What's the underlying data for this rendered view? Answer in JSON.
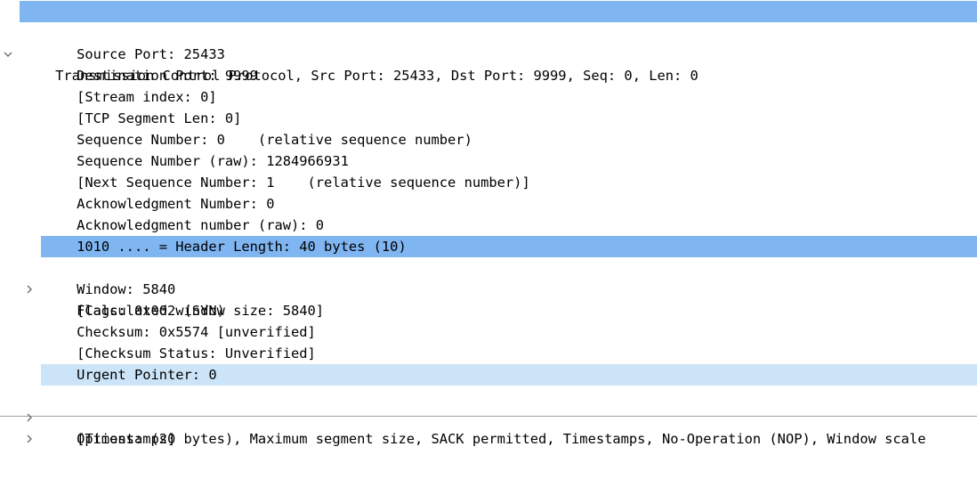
{
  "tree": {
    "header": {
      "label": "Transmission Control Protocol, Src Port: 25433, Dst Port: 9999, Seq: 0, Len: 0",
      "expanded": true,
      "icon": "chevron-down-icon"
    },
    "fields": [
      {
        "label": "Source Port: 25433"
      },
      {
        "label": "Destination Port: 9999"
      },
      {
        "label": "[Stream index: 0]"
      },
      {
        "label": "[TCP Segment Len: 0]"
      },
      {
        "label": "Sequence Number: 0    (relative sequence number)"
      },
      {
        "label": "Sequence Number (raw): 1284966931"
      },
      {
        "label": "[Next Sequence Number: 1    (relative sequence number)]"
      },
      {
        "label": "Acknowledgment Number: 0"
      },
      {
        "label": "Acknowledgment number (raw): 0"
      },
      {
        "label": "1010 .... = Header Length: 40 bytes (10)"
      },
      {
        "label": "Flags: 0x002 (SYN)",
        "expandable": true,
        "icon": "chevron-right-icon"
      },
      {
        "label": "Window: 5840"
      },
      {
        "label": "[Calculated window size: 5840]"
      },
      {
        "label": "Checksum: 0x5574 [unverified]"
      },
      {
        "label": "[Checksum Status: Unverified]"
      },
      {
        "label": "Urgent Pointer: 0"
      },
      {
        "label": "Options: (20 bytes), Maximum segment size, SACK permitted, Timestamps, No-Operation (NOP), Window scale",
        "expandable": true,
        "icon": "chevron-right-icon"
      },
      {
        "label": "[Timestamps]",
        "expandable": true,
        "icon": "chevron-right-icon"
      }
    ]
  },
  "colors": {
    "selected_strong": "#7fb5f1",
    "selected_light": "#cce4f7",
    "arrow": "#6e6e6e"
  }
}
